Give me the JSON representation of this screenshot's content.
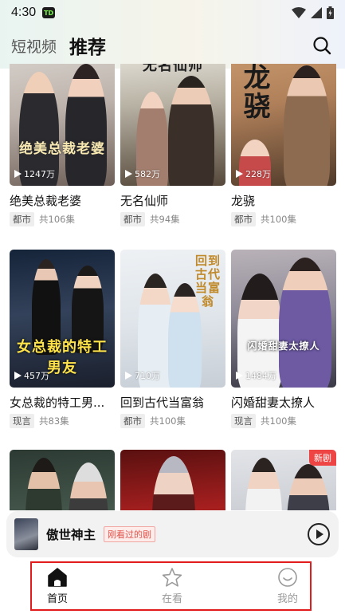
{
  "status_bar": {
    "time": "4:30",
    "app_icon_text": "TD"
  },
  "header": {
    "tab_short_video": "短视频",
    "tab_recommend": "推荐"
  },
  "cards": [
    {
      "title": "绝美总裁老婆",
      "genre": "都市",
      "episodes": "共106集",
      "plays": "1247万",
      "art_text": "绝美总裁老婆"
    },
    {
      "title": "无名仙师",
      "genre": "都市",
      "episodes": "共94集",
      "plays": "582万",
      "art_text": "无名仙师"
    },
    {
      "title": "龙骁",
      "genre": "都市",
      "episodes": "共100集",
      "plays": "228万",
      "art_text": "龙骁"
    },
    {
      "title": "女总裁的特工男...",
      "genre": "现言",
      "episodes": "共83集",
      "plays": "457万",
      "art_text": "女总裁的特工男友"
    },
    {
      "title": "回到古代当富翁",
      "genre": "都市",
      "episodes": "共100集",
      "plays": "710万",
      "art_text": "回到古代当富翁"
    },
    {
      "title": "闪婚甜妻太撩人",
      "genre": "现言",
      "episodes": "共100集",
      "plays": "1484万",
      "art_text": "闪婚甜妻太撩人"
    },
    {
      "title": "",
      "genre": "",
      "episodes": "",
      "plays": "",
      "art_text": ""
    },
    {
      "title": "",
      "genre": "",
      "episodes": "",
      "plays": "",
      "art_text": ""
    },
    {
      "title": "",
      "genre": "",
      "episodes": "",
      "plays": "",
      "art_text": "",
      "badge": "新剧"
    }
  ],
  "mini_player": {
    "title": "傲世神主",
    "tag": "刚看过的剧"
  },
  "bottom_nav": {
    "home": "首页",
    "watching": "在看",
    "mine": "我的"
  },
  "colors": {
    "accent_red": "#e21c1c",
    "new_badge": "#ee4444"
  }
}
